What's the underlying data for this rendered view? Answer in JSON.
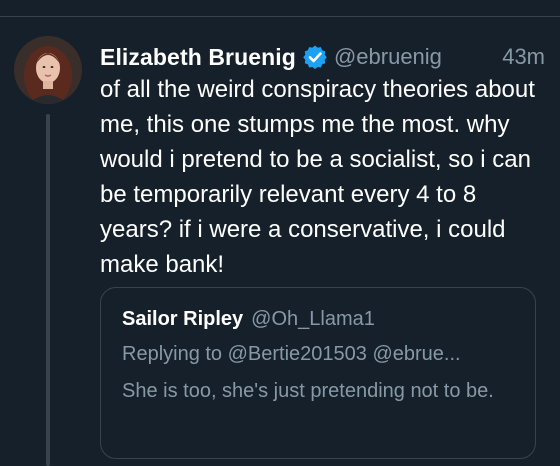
{
  "tweet": {
    "author_name": "Elizabeth Bruenig",
    "handle": "@ebruenig",
    "time": "43m",
    "text": "of all the weird conspiracy theories about me, this one stumps me the most. why would i pretend to be a socialist, so i can be temporarily relevant every 4 to 8 years? if i were a conservative, i could make bank!",
    "avatar_icon": "profile-photo",
    "verified_icon": "verified-badge-icon"
  },
  "quote": {
    "author_name": "Sailor Ripley",
    "handle": "@Oh_Llama1",
    "replying": "Replying to @Bertie201503 @ebrue...",
    "text": "She is too, she's just pretending not to be."
  },
  "colors": {
    "background": "#15202b",
    "border": "#38444d",
    "muted": "#8899a6",
    "accent": "#1da1f2",
    "text": "#ffffff"
  }
}
